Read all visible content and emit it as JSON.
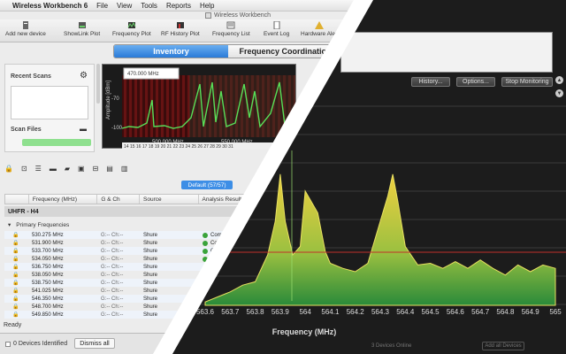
{
  "menubar": {
    "app": "Wireless Workbench 6",
    "items": [
      "File",
      "View",
      "Tools",
      "Reports",
      "Help"
    ]
  },
  "window_title": "Wireless Workbench",
  "toolbar": [
    "Add new device",
    "ShowLink Plot",
    "Frequency Plot",
    "RF History Plot",
    "Frequency List",
    "Event Log",
    "Hardware Aler"
  ],
  "tabs": {
    "inventory": "Inventory",
    "coordination": "Frequency Coordination"
  },
  "recent_scans": {
    "title": "Recent Scans"
  },
  "scan_files": {
    "title": "Scan Files"
  },
  "small_plot": {
    "ylabel": "Amplitude [dBm]",
    "marker_label": "470.000 MHz",
    "yticks": [
      "-70",
      "-100"
    ],
    "xticks": [
      "500.000 MHz",
      "550.000 MHz"
    ],
    "channels": "14 15 16 17 18 19 20 21 22 23 24 25 26 27 28 29 30 31"
  },
  "default_button": "Default (57/57)",
  "table": {
    "headers": [
      "",
      "Frequency (MHz)",
      "G & Ch",
      "Source",
      "Analysis Result"
    ],
    "group": "UHFR - H4",
    "subgroup": "Primary Frequencies",
    "rows": [
      {
        "freq": "530.275 MHz",
        "gch": "G:-- Ch:--",
        "src": "Shure",
        "res": "Com"
      },
      {
        "freq": "531.900 MHz",
        "gch": "G:-- Ch:--",
        "src": "Shure",
        "res": "Co"
      },
      {
        "freq": "533.700 MHz",
        "gch": "G:-- Ch:--",
        "src": "Shure",
        "res": "C"
      },
      {
        "freq": "534.050 MHz",
        "gch": "G:-- Ch:--",
        "src": "Shure",
        "res": "C"
      },
      {
        "freq": "536.750 MHz",
        "gch": "G:-- Ch:--",
        "src": "Shure",
        "res": ""
      },
      {
        "freq": "538.050 MHz",
        "gch": "G:-- Ch:--",
        "src": "Shure",
        "res": ""
      },
      {
        "freq": "538.750 MHz",
        "gch": "G:-- Ch:--",
        "src": "Shure",
        "res": ""
      },
      {
        "freq": "541.025 MHz",
        "gch": "G:-- Ch:--",
        "src": "Shure",
        "res": ""
      },
      {
        "freq": "546.350 MHz",
        "gch": "G:-- Ch:--",
        "src": "Shure",
        "res": ""
      },
      {
        "freq": "548.700 MHz",
        "gch": "G:-- Ch:--",
        "src": "Shure",
        "res": ""
      },
      {
        "freq": "549.850 MHz",
        "gch": "G:-- Ch:--",
        "src": "Shure",
        "res": ""
      }
    ]
  },
  "status": "Ready",
  "bottom": {
    "devices": "0 Devices Identified",
    "dismiss": "Dismiss all"
  },
  "monitor": {
    "buttons": {
      "history": "History...",
      "options": "Options...",
      "stop": "Stop Monitoring"
    },
    "xlabel": "Frequency (MHz)",
    "xticks": [
      "563.6",
      "563.7",
      "563.8",
      "563.9",
      "564",
      "564.1",
      "564.2",
      "564.3",
      "564.4",
      "564.5",
      "564.6",
      "564.7",
      "564.8",
      "564.9",
      "565"
    ],
    "bottom_text": "3 Devices Online",
    "bottom_btn": "Add all Devices"
  },
  "colors": {
    "accent": "#2a7ad8",
    "spectrum_top": "#f0d040",
    "spectrum_bottom": "#2a8a3a",
    "threshold": "#c0302a"
  },
  "chart_data": {
    "type": "area",
    "x": [
      563.6,
      563.65,
      563.7,
      563.75,
      563.8,
      563.85,
      563.88,
      563.9,
      563.92,
      563.95,
      563.98,
      564.0,
      564.05,
      564.08,
      564.1,
      564.15,
      564.2,
      564.25,
      564.3,
      564.33,
      564.35,
      564.37,
      564.4,
      564.45,
      564.5,
      564.55,
      564.6,
      564.65,
      564.7,
      564.75,
      564.8,
      564.85,
      564.9,
      564.95,
      565.0
    ],
    "y": [
      0.02,
      0.05,
      0.08,
      0.12,
      0.14,
      0.3,
      0.5,
      0.78,
      0.5,
      0.3,
      0.35,
      0.68,
      0.55,
      0.32,
      0.25,
      0.22,
      0.2,
      0.25,
      0.5,
      0.65,
      0.78,
      0.62,
      0.35,
      0.24,
      0.25,
      0.22,
      0.26,
      0.22,
      0.27,
      0.22,
      0.18,
      0.24,
      0.2,
      0.24,
      0.22
    ],
    "xlabel": "Frequency (MHz)",
    "xlim": [
      563.6,
      565.0
    ],
    "ylim": [
      0,
      1
    ],
    "grid": true
  }
}
